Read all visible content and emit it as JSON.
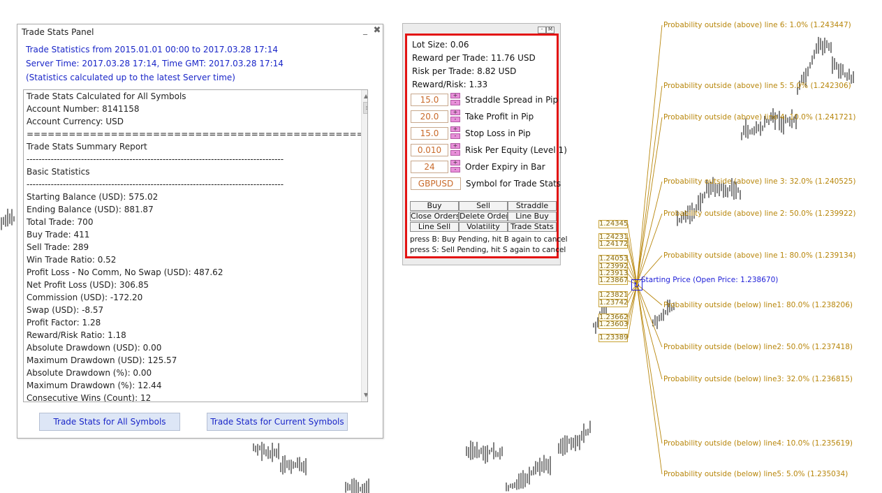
{
  "trade_stats_panel": {
    "title": "Trade Stats Panel",
    "minimize_label": "_",
    "close_label": "✖",
    "header_lines": [
      "Trade Statistics from 2015.01.01 00:00 to 2017.03.28 17:14",
      "Server Time: 2017.03.28 17:14, Time GMT: 2017.03.28 17:14",
      "(Statistics calculated up to the latest Server time)"
    ],
    "report_lines": [
      "Trade Stats Calculated for All Symbols",
      "Account Number: 8141158",
      "Account Currency: USD",
      "===================================================================",
      "Trade Stats Summary Report",
      "-------------------------------------------------------------------------------------",
      "Basic Statistics",
      "-------------------------------------------------------------------------------------",
      "Starting Balance (USD): 575.02",
      "Ending Balance (USD): 881.87",
      "Total Trade: 700",
      "Buy Trade: 411",
      "Sell Trade: 289",
      "Win Trade Ratio: 0.52",
      "Profit Loss - No Comm, No Swap (USD): 487.62",
      "Net Profit Loss (USD): 306.85",
      "Commission (USD): -172.20",
      "Swap (USD): -8.57",
      "Profit Factor: 1.28",
      "Reward/Risk Ratio: 1.18",
      "Absolute Drawdown (USD): 0.00",
      "Maximum Drawdown (USD): 125.57",
      "Absolute Drawdown (%): 0.00",
      "Maximum Drawdown (%): 12.44",
      "Consecutive Wins (Count): 12"
    ],
    "buttons": {
      "all_symbols": "Trade Stats for All Symbols",
      "current_symbols": "Trade Stats for Current Symbols"
    }
  },
  "straddle_panel": {
    "window_controls": [
      "-",
      "M"
    ],
    "info": [
      "Lot Size: 0.06",
      "Reward per Trade: 11.76 USD",
      "Risk per Trade: 8.82 USD",
      "Reward/Risk: 1.33"
    ],
    "plus_label": "+",
    "minus_label": "-",
    "params": [
      {
        "value": "15.0",
        "label": "Straddle Spread in Pip"
      },
      {
        "value": "20.0",
        "label": "Take Profit in Pip"
      },
      {
        "value": "15.0",
        "label": "Stop Loss in Pip"
      },
      {
        "value": "0.010",
        "label": "Risk Per Equity (Level 1)"
      },
      {
        "value": "24",
        "label": "Order Expiry in Bar"
      }
    ],
    "symbol": {
      "value": "GBPUSD",
      "label": "Symbol for Trade Stats"
    },
    "buttons": [
      "Buy",
      "Sell",
      "Straddle",
      "Close Orders",
      "Delete Orders",
      "Line Buy",
      "Line Sell",
      "Volatility",
      "Trade Stats"
    ],
    "hints": [
      "press B: Buy Pending, hit B again to cancel",
      "press S: Sell Pending, hit S again to cancel"
    ]
  },
  "chart": {
    "probability_lines": [
      "Probability outside (above) line 6: 1.0% (1.243447)",
      "Probability outside (above) line 5: 5.0% (1.242306)",
      "Probability outside (above) line 4: 10.0% (1.241721)",
      "Probability outside (above) line 3: 32.0% (1.240525)",
      "Probability outside (above) line 2: 50.0% (1.239922)",
      "Probability outside (above) line 1: 80.0% (1.239134)",
      "Probability outside (below) line1: 80.0% (1.238206)",
      "Probability outside (below) line2: 50.0% (1.237418)",
      "Probability outside (below) line3: 32.0% (1.236815)",
      "Probability outside (below) line4: 10.0% (1.235619)",
      "Probability outside (below) line5: 5.0% (1.235034)"
    ],
    "starting_price_label": "Starting Price (Open Price: 1.238670)",
    "price_labels": [
      "1.24345",
      "1.24231",
      "1.24172",
      "1.24053",
      "1.23992",
      "1.23913",
      "1.23867",
      "1.23821",
      "1.23742",
      "1.23662",
      "1.23603",
      "1.23389"
    ],
    "colors": {
      "probability": "#b8860b",
      "start": "#2020d8",
      "panel_border": "#e31212",
      "candles": "#000000"
    }
  }
}
